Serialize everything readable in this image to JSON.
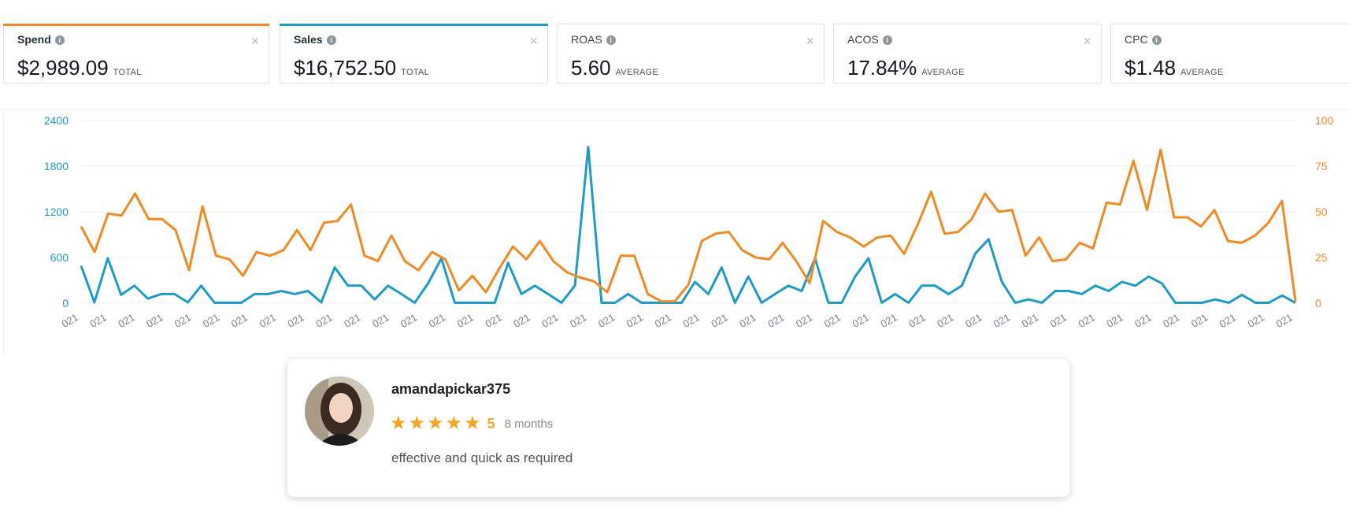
{
  "metrics": [
    {
      "title": "Spend",
      "value": "$2,989.09",
      "suffix": "TOTAL",
      "accent": "#f08a24",
      "closable": true
    },
    {
      "title": "Sales",
      "value": "$16,752.50",
      "suffix": "TOTAL",
      "accent": "#1f9bc7",
      "closable": true
    },
    {
      "title": "ROAS",
      "value": "5.60",
      "suffix": "AVERAGE",
      "accent": "",
      "closable": true
    },
    {
      "title": "ACOS",
      "value": "17.84%",
      "suffix": "AVERAGE",
      "accent": "",
      "closable": true
    },
    {
      "title": "CPC",
      "value": "$1.48",
      "suffix": "AVERAGE",
      "accent": "",
      "closable": false
    }
  ],
  "colors": {
    "sales_line": "#1f9bc7",
    "acos_line": "#f08a24",
    "grid": "#eef0f2",
    "star": "#f5a623"
  },
  "chart_data": {
    "type": "line",
    "y_left": {
      "ticks": [
        0,
        600,
        1200,
        1800,
        2400
      ],
      "range": [
        0,
        2400
      ],
      "color": "#1f9bc7"
    },
    "y_right": {
      "ticks": [
        0,
        25,
        50,
        75,
        100
      ],
      "range": [
        0,
        100
      ],
      "color": "#f08a24"
    },
    "x_tick_label": "021",
    "x_tick_count": 44,
    "series": [
      {
        "axis": "left",
        "color": "#1f9bc7",
        "values": [
          490,
          10,
          590,
          110,
          230,
          60,
          120,
          120,
          10,
          230,
          5,
          5,
          5,
          120,
          120,
          160,
          120,
          160,
          10,
          470,
          230,
          230,
          50,
          230,
          120,
          5,
          260,
          590,
          5,
          5,
          5,
          5,
          530,
          120,
          230,
          120,
          5,
          230,
          2050,
          5,
          5,
          120,
          5,
          5,
          5,
          5,
          280,
          120,
          470,
          5,
          350,
          5,
          120,
          230,
          160,
          590,
          5,
          5,
          350,
          590,
          5,
          120,
          5,
          230,
          230,
          120,
          230,
          650,
          840,
          280,
          5,
          50,
          5,
          160,
          160,
          120,
          230,
          160,
          280,
          230,
          350,
          260,
          5,
          5,
          5,
          50,
          5,
          110,
          5,
          5,
          100,
          5
        ]
      },
      {
        "axis": "right",
        "color": "#f08a24",
        "values": [
          42,
          28,
          49,
          48,
          60,
          46,
          46,
          40,
          18,
          53,
          26,
          24,
          15,
          28,
          26,
          29,
          40,
          29,
          44,
          45,
          54,
          26,
          23,
          37,
          23,
          18,
          28,
          24,
          7,
          15,
          6,
          19,
          31,
          24,
          34,
          23,
          17,
          14,
          12,
          6,
          26,
          26,
          5,
          1,
          1,
          10,
          34,
          38,
          39,
          29,
          25,
          24,
          33,
          23,
          11,
          45,
          39,
          36,
          31,
          36,
          37,
          27,
          43,
          61,
          38,
          39,
          46,
          60,
          50,
          51,
          26,
          36,
          23,
          24,
          33,
          30,
          55,
          54,
          78,
          51,
          84,
          47,
          47,
          42,
          51,
          34,
          33,
          37,
          44,
          56,
          1
        ]
      }
    ]
  },
  "review": {
    "username": "amandapickar375",
    "rating": "5",
    "time_ago": "8 months",
    "comment": "effective and quick as required"
  }
}
